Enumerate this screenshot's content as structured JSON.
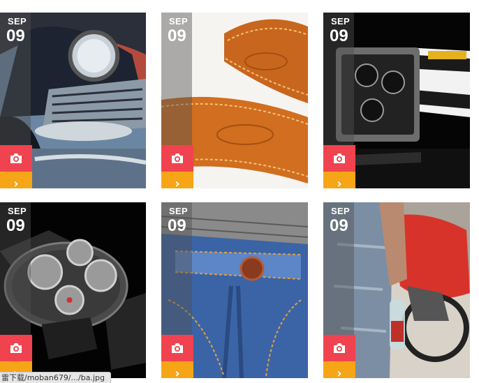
{
  "posts": [
    {
      "month": "SEP",
      "day": "09",
      "image": "vintage-car-photo"
    },
    {
      "month": "SEP",
      "day": "09",
      "image": "leather-belt-photo"
    },
    {
      "month": "SEP",
      "day": "09",
      "image": "square-watch-photo"
    },
    {
      "month": "SEP",
      "day": "09",
      "image": "round-watch-photo"
    },
    {
      "month": "SEP",
      "day": "09",
      "image": "jeans-photo"
    },
    {
      "month": "SEP",
      "day": "09",
      "image": "motorcycle-man-photo"
    }
  ],
  "colors": {
    "camera_button": "#f0434f",
    "more_button": "#f6a516",
    "date_overlay": "rgba(80,80,80,0.45)"
  },
  "icons": {
    "camera": "camera-icon",
    "more": "chevron-right-icon"
  },
  "status_bar": {
    "url": "雷下载/moban679/.../ba.jpg"
  }
}
